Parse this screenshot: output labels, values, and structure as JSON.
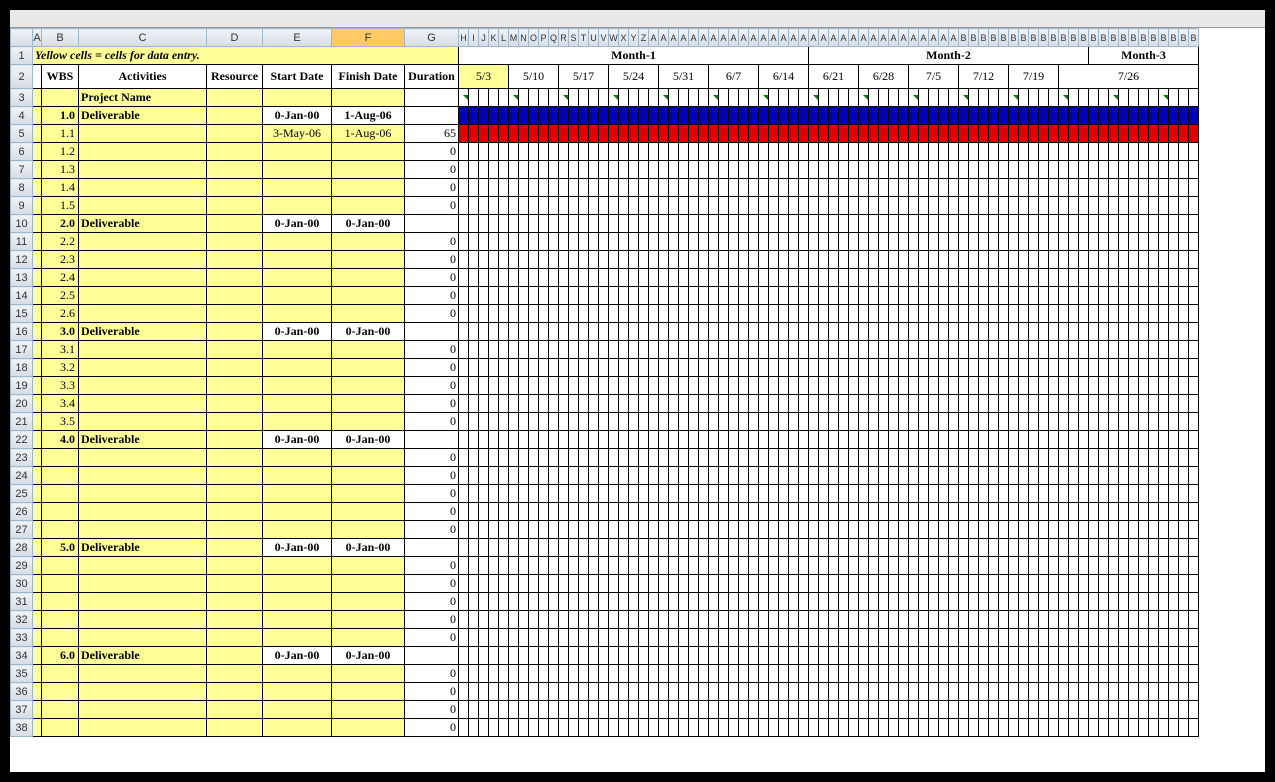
{
  "columns": {
    "narrowLetters": [
      "H",
      "I",
      "J",
      "K",
      "L",
      "M",
      "N",
      "O",
      "P",
      "Q",
      "R",
      "S",
      "T",
      "U",
      "V",
      "W",
      "X",
      "Y",
      "Z",
      "A",
      "A",
      "A",
      "A",
      "A",
      "A",
      "A",
      "A",
      "A",
      "A",
      "A",
      "A",
      "A",
      "A",
      "A",
      "A",
      "A",
      "A",
      "A",
      "A",
      "A",
      "A",
      "A",
      "A",
      "A",
      "A",
      "A",
      "A",
      "A",
      "A",
      "A",
      "B",
      "B",
      "B",
      "B",
      "B",
      "B",
      "B",
      "B",
      "B",
      "B",
      "B",
      "B",
      "B",
      "B",
      "B",
      "B",
      "B",
      "B",
      "B",
      "B",
      "B",
      "B",
      "B",
      "B"
    ],
    "main": [
      "A",
      "B",
      "C",
      "D",
      "E",
      "F",
      "G"
    ]
  },
  "note": "Yellow cells = cells for data entry.",
  "headers": {
    "wbs": "WBS",
    "activities": "Activities",
    "resource": "Resource",
    "start": "Start Date",
    "finish": "Finish Date",
    "duration": "Duration"
  },
  "months": [
    "Month-1",
    "Month-2",
    "Month-3"
  ],
  "weeks": [
    "5/3",
    "5/10",
    "5/17",
    "5/24",
    "5/31",
    "6/7",
    "6/14",
    "6/21",
    "6/28",
    "7/5",
    "7/12",
    "7/19",
    "7/26"
  ],
  "projectName": "Project Name",
  "rows": [
    {
      "r": 4,
      "wbs": "1.0",
      "act": "Deliverable",
      "start": "0-Jan-00",
      "finish": "1-Aug-06",
      "dur": "",
      "bold": true,
      "bar": "blue"
    },
    {
      "r": 5,
      "wbs": "1.1",
      "act": "",
      "start": "3-May-06",
      "finish": "1-Aug-06",
      "dur": "65",
      "bar": "red"
    },
    {
      "r": 6,
      "wbs": "1.2",
      "act": "",
      "start": "",
      "finish": "",
      "dur": "0"
    },
    {
      "r": 7,
      "wbs": "1.3",
      "act": "",
      "start": "",
      "finish": "",
      "dur": "0"
    },
    {
      "r": 8,
      "wbs": "1.4",
      "act": "",
      "start": "",
      "finish": "",
      "dur": "0"
    },
    {
      "r": 9,
      "wbs": "1.5",
      "act": "",
      "start": "",
      "finish": "",
      "dur": "0"
    },
    {
      "r": 10,
      "wbs": "2.0",
      "act": "Deliverable",
      "start": "0-Jan-00",
      "finish": "0-Jan-00",
      "dur": "",
      "bold": true
    },
    {
      "r": 11,
      "wbs": "2.2",
      "act": "",
      "start": "",
      "finish": "",
      "dur": "0"
    },
    {
      "r": 12,
      "wbs": "2.3",
      "act": "",
      "start": "",
      "finish": "",
      "dur": "0"
    },
    {
      "r": 13,
      "wbs": "2.4",
      "act": "",
      "start": "",
      "finish": "",
      "dur": "0"
    },
    {
      "r": 14,
      "wbs": "2.5",
      "act": "",
      "start": "",
      "finish": "",
      "dur": "0"
    },
    {
      "r": 15,
      "wbs": "2.6",
      "act": "",
      "start": "",
      "finish": "",
      "dur": "0"
    },
    {
      "r": 16,
      "wbs": "3.0",
      "act": "Deliverable",
      "start": "0-Jan-00",
      "finish": "0-Jan-00",
      "dur": "",
      "bold": true
    },
    {
      "r": 17,
      "wbs": "3.1",
      "act": "",
      "start": "",
      "finish": "",
      "dur": "0"
    },
    {
      "r": 18,
      "wbs": "3.2",
      "act": "",
      "start": "",
      "finish": "",
      "dur": "0"
    },
    {
      "r": 19,
      "wbs": "3.3",
      "act": "",
      "start": "",
      "finish": "",
      "dur": "0"
    },
    {
      "r": 20,
      "wbs": "3.4",
      "act": "",
      "start": "",
      "finish": "",
      "dur": "0"
    },
    {
      "r": 21,
      "wbs": "3.5",
      "act": "",
      "start": "",
      "finish": "",
      "dur": "0"
    },
    {
      "r": 22,
      "wbs": "4.0",
      "act": "Deliverable",
      "start": "0-Jan-00",
      "finish": "0-Jan-00",
      "dur": "",
      "bold": true
    },
    {
      "r": 23,
      "wbs": "",
      "act": "",
      "start": "",
      "finish": "",
      "dur": "0"
    },
    {
      "r": 24,
      "wbs": "",
      "act": "",
      "start": "",
      "finish": "",
      "dur": "0"
    },
    {
      "r": 25,
      "wbs": "",
      "act": "",
      "start": "",
      "finish": "",
      "dur": "0"
    },
    {
      "r": 26,
      "wbs": "",
      "act": "",
      "start": "",
      "finish": "",
      "dur": "0"
    },
    {
      "r": 27,
      "wbs": "",
      "act": "",
      "start": "",
      "finish": "",
      "dur": "0"
    },
    {
      "r": 28,
      "wbs": "5.0",
      "act": "Deliverable",
      "start": "0-Jan-00",
      "finish": "0-Jan-00",
      "dur": "",
      "bold": true
    },
    {
      "r": 29,
      "wbs": "",
      "act": "",
      "start": "",
      "finish": "",
      "dur": "0"
    },
    {
      "r": 30,
      "wbs": "",
      "act": "",
      "start": "",
      "finish": "",
      "dur": "0"
    },
    {
      "r": 31,
      "wbs": "",
      "act": "",
      "start": "",
      "finish": "",
      "dur": "0"
    },
    {
      "r": 32,
      "wbs": "",
      "act": "",
      "start": "",
      "finish": "",
      "dur": "0"
    },
    {
      "r": 33,
      "wbs": "",
      "act": "",
      "start": "",
      "finish": "",
      "dur": "0"
    },
    {
      "r": 34,
      "wbs": "6.0",
      "act": "Deliverable",
      "start": "0-Jan-00",
      "finish": "0-Jan-00",
      "dur": "",
      "bold": true
    },
    {
      "r": 35,
      "wbs": "",
      "act": "",
      "start": "",
      "finish": "",
      "dur": "0"
    },
    {
      "r": 36,
      "wbs": "",
      "act": "",
      "start": "",
      "finish": "",
      "dur": "0"
    },
    {
      "r": 37,
      "wbs": "",
      "act": "",
      "start": "",
      "finish": "",
      "dur": "0"
    },
    {
      "r": 38,
      "wbs": "",
      "act": "",
      "start": "",
      "finish": "",
      "dur": "0"
    }
  ],
  "geom": {
    "aW": 9,
    "bW": 37,
    "cW": 128,
    "dW": 56,
    "eW": 69,
    "fW": 73,
    "gW": 54,
    "dayW": 10,
    "daysPerWeek": 7,
    "weeksPerMonth1": 5,
    "weeksPerMonth2": 4,
    "weeksPerMonth3": 4,
    "days": 74
  }
}
